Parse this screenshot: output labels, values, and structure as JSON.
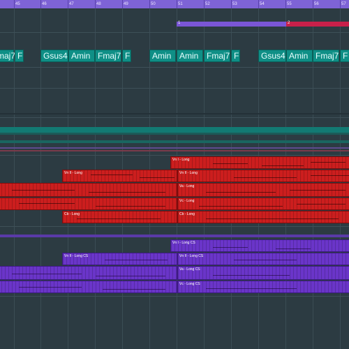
{
  "ruler": {
    "bars": [
      "45",
      "46",
      "47",
      "48",
      "49",
      "50",
      "51",
      "52",
      "53",
      "54",
      "55",
      "56",
      "57"
    ]
  },
  "arranger": {
    "sections": [
      {
        "label": "1",
        "color": "#7a56d6"
      },
      {
        "label": "2",
        "color": "#c8204a"
      }
    ]
  },
  "chords": [
    "maj7",
    "F",
    "Gsus4",
    "Amin",
    "Fmaj7",
    "F",
    "Amin",
    "Amin",
    "Fmaj7",
    "F",
    "Gsus4",
    "Amin",
    "Fmaj7",
    "F"
  ],
  "strings": {
    "color": "#cc1e1e",
    "parts": [
      "Vn I - Long",
      "Vn II - Long",
      "Vn II - Long",
      "Va - Long",
      "Vc - Long",
      "Cb - Long",
      "Cb - Long"
    ]
  },
  "cs": {
    "color": "#6a35c9",
    "parts": [
      "Vn I - Long CS",
      "Vn II - Long CS",
      "Vn II - Long CS",
      "Va - Long CS",
      "Vc - Long CS"
    ]
  },
  "colors": {
    "background": "#2c3b42",
    "ruler": "#7e63d6",
    "chord": "#0f8f86",
    "folder_teal": "#127a73"
  }
}
